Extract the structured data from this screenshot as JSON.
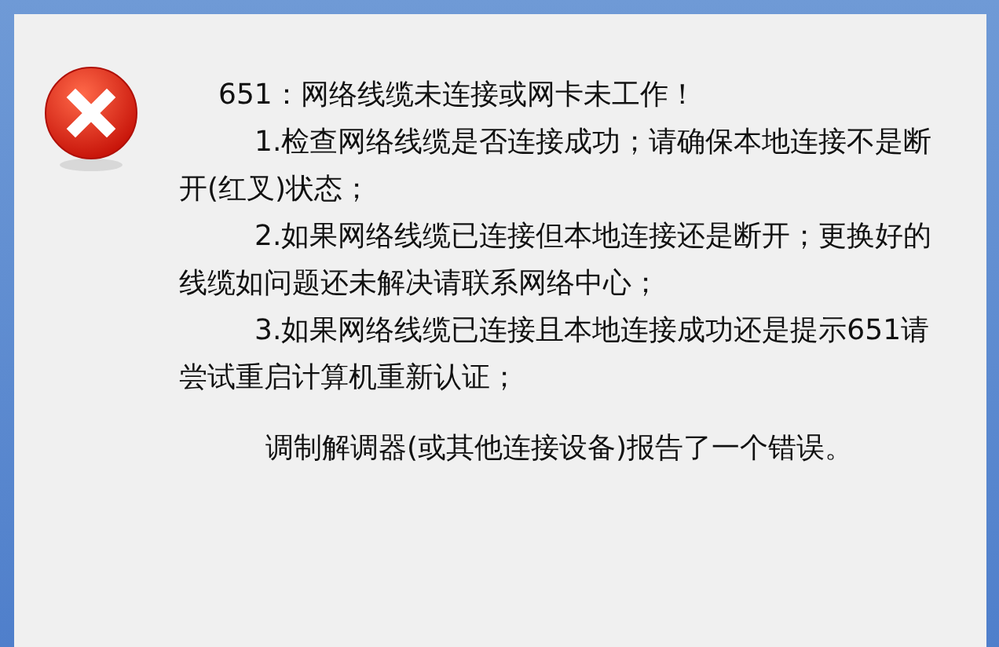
{
  "dialog": {
    "kind": "error",
    "heading": "651：网络线缆未连接或网卡未工作！",
    "steps": [
      "1.检查网络线缆是否连接成功；请确保本地连接不是断开(红叉)状态；",
      "2.如果网络线缆已连接但本地连接还是断开；更换好的线缆如问题还未解决请联系网络中心；",
      "3.如果网络线缆已连接且本地连接成功还是提示651请尝试重启计算机重新认证；"
    ],
    "footer": "调制解调器(或其他连接设备)报告了一个错误。"
  }
}
